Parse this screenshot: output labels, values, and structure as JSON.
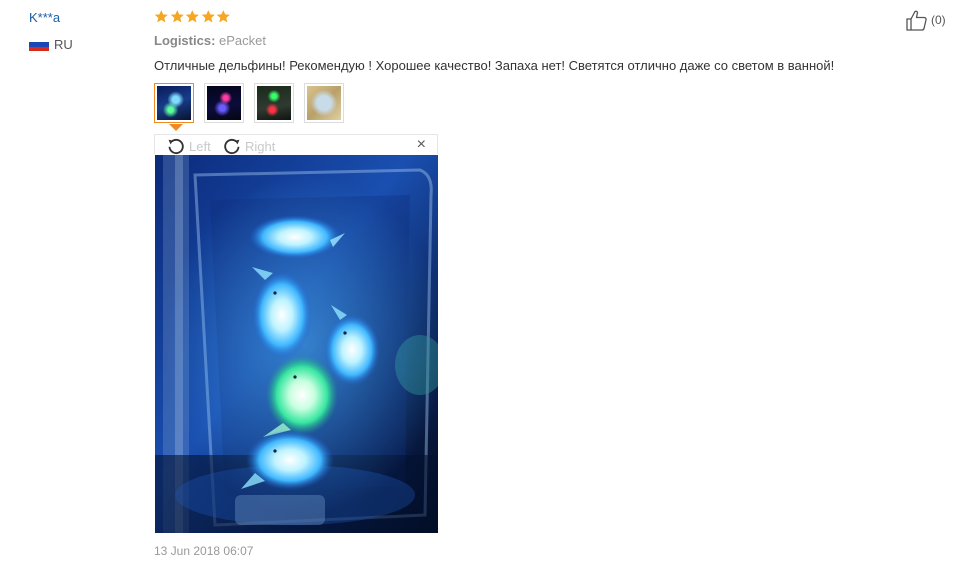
{
  "user": {
    "name": "K***a",
    "country": "RU",
    "flag_icon": "russia-flag-icon"
  },
  "rating": {
    "stars": 5,
    "max": 5,
    "color": "#f5a623"
  },
  "logistics": {
    "label": "Logistics:",
    "value": "ePacket"
  },
  "review_text": "Отличные дельфины! Рекомендую ! Хорошее качество! Запаха нет! Светятся отлично даже со светом в ванной!",
  "viewer": {
    "rotate_left_label": "Left",
    "rotate_right_label": "Right",
    "close_label": "×"
  },
  "date": "13 Jun 2018 06:07",
  "like": {
    "count_label": "(0)"
  },
  "colors": {
    "accent": "#f08a24",
    "link": "#1a5fa8"
  }
}
